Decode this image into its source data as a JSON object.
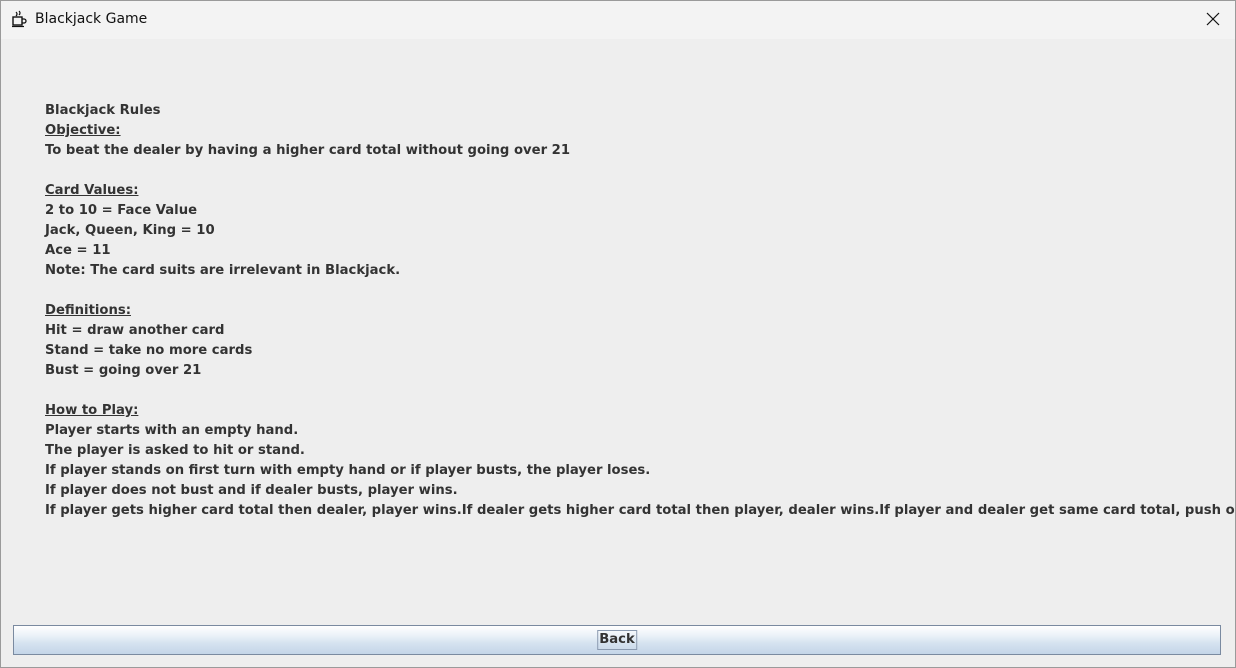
{
  "window": {
    "title": "Blackjack Game",
    "icon": "java-cup-icon",
    "close_icon": "close-icon"
  },
  "rules": {
    "heading": "Blackjack Rules",
    "objective": {
      "title": "Objective:",
      "lines": [
        "To beat the dealer by having a higher card total without going over 21"
      ]
    },
    "card_values": {
      "title": "Card Values:",
      "lines": [
        "2 to 10 = Face Value",
        "Jack, Queen, King = 10",
        "Ace = 11",
        "Note: The card suits are irrelevant in Blackjack."
      ]
    },
    "definitions": {
      "title": "Definitions:",
      "lines": [
        "Hit = draw another card",
        "Stand = take no more cards",
        "Bust = going over 21"
      ]
    },
    "how_to_play": {
      "title": "How to Play:",
      "lines": [
        "Player starts with an empty hand.",
        "The player is asked to hit or stand.",
        "If player stands on first turn with empty hand or if player busts, the player loses.",
        "If player does not bust and if dealer busts, player wins.",
        "If player gets higher card total then dealer, player wins.If dealer gets higher card total then player, dealer wins.If player and dealer get same card total, push occurs."
      ]
    }
  },
  "back_button": {
    "label": "Back"
  },
  "colors": {
    "background": "#eeeeee",
    "text": "#333333",
    "button_border": "#7a8aa0"
  }
}
